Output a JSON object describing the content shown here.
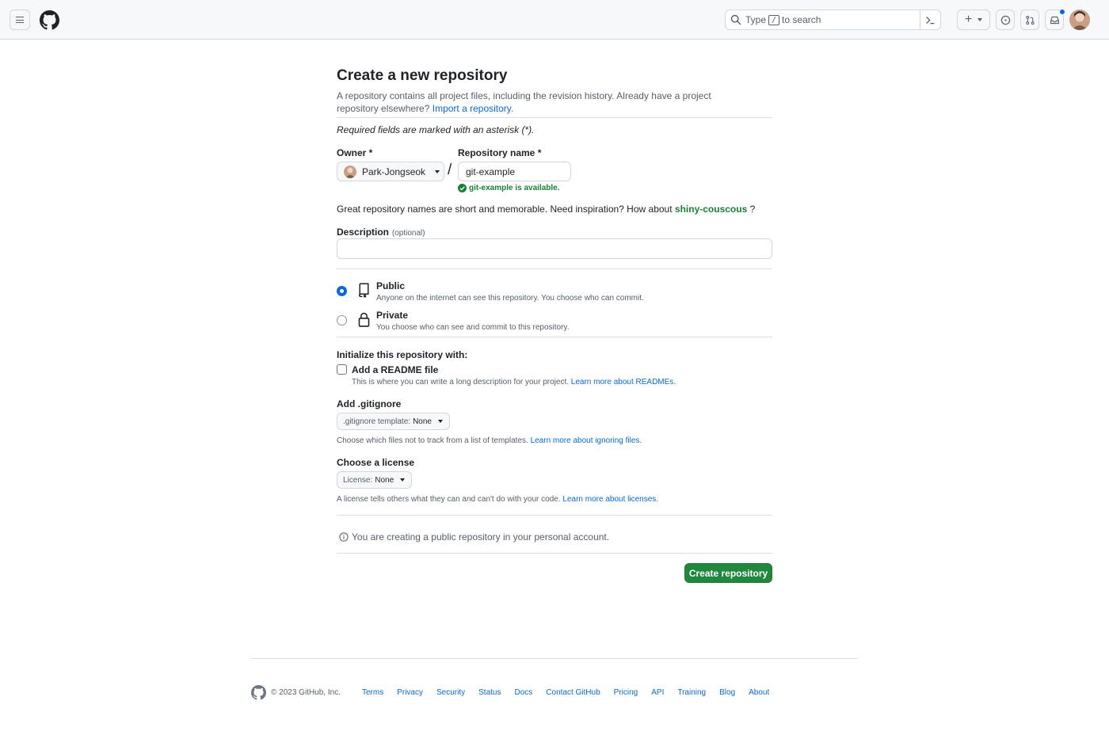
{
  "header": {
    "search_prefix": "Type",
    "search_key": "/",
    "search_suffix": "to search",
    "plus_label": "+"
  },
  "page": {
    "title": "Create a new repository",
    "subtitle": "A repository contains all project files, including the revision history. Already have a project repository elsewhere?",
    "import_link": "Import a repository.",
    "required_note": "Required fields are marked with an asterisk (*).",
    "owner_label": "Owner *",
    "owner_value": "Park-Jongseok",
    "slash": "/",
    "repo_label": "Repository name *",
    "repo_value": "git-example",
    "availability": "git-example is available.",
    "inspiration_text": "Great repository names are short and memorable. Need inspiration? How about",
    "suggestion": "shiny-couscous",
    "inspiration_end": "?",
    "description_label": "Description",
    "description_optional": "(optional)",
    "description_value": "",
    "visibility": [
      {
        "title": "Public",
        "desc": "Anyone on the internet can see this repository. You choose who can commit.",
        "checked": true
      },
      {
        "title": "Private",
        "desc": "You choose who can see and commit to this repository.",
        "checked": false
      }
    ],
    "init_label": "Initialize this repository with:",
    "readme_label": "Add a README file",
    "readme_desc": "This is where you can write a long description for your project.",
    "readme_link": "Learn more about READMEs.",
    "gitignore_label": "Add .gitignore",
    "gitignore_prefix": ".gitignore template:",
    "gitignore_value": "None",
    "gitignore_desc": "Choose which files not to track from a list of templates.",
    "gitignore_link": "Learn more about ignoring files.",
    "license_label": "Choose a license",
    "license_prefix": "License:",
    "license_value": "None",
    "license_desc": "A license tells others what they can and can't do with your code.",
    "license_link": "Learn more about licenses.",
    "info_text": "You are creating a public repository in your personal account.",
    "create_button": "Create repository"
  },
  "footer": {
    "copyright": "© 2023 GitHub, Inc.",
    "links": [
      "Terms",
      "Privacy",
      "Security",
      "Status",
      "Docs",
      "Contact GitHub",
      "Pricing",
      "API",
      "Training",
      "Blog",
      "About"
    ]
  },
  "colors": {
    "primary_green": "#1f883d",
    "link_blue": "#0969da",
    "success_green": "#1a7f37"
  }
}
